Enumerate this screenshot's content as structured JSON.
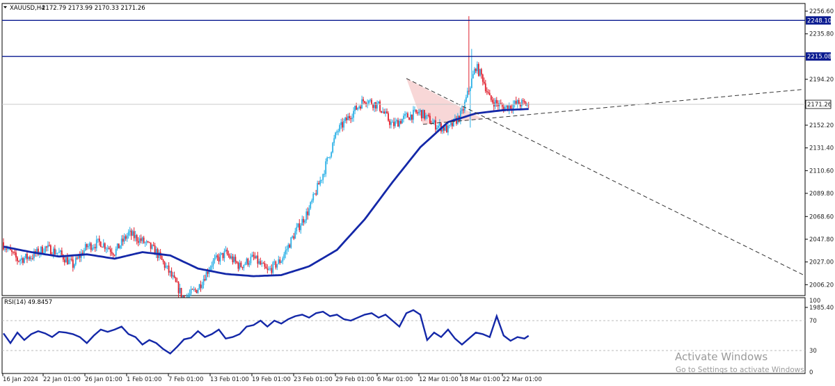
{
  "header": {
    "symbol": "XAUUSD,H4",
    "ohlc": "2172.79 2173.99 2170.33 2171.26"
  },
  "rsi_header": "RSI(14) 49.8457",
  "watermark": {
    "title": "Activate Windows",
    "subtitle": "Go to Settings to activate Windows."
  },
  "colors": {
    "bull_candle": "#2ab0e6",
    "bear_candle": "#e0202e",
    "moving_average": "#1428a8",
    "hline": "#0a1a90",
    "rsi_line": "#1428a8",
    "triangle_fill": "#f6c9c9"
  },
  "chart_data": [
    {
      "type": "candlestick",
      "symbol": "XAUUSD",
      "timeframe": "H4",
      "y_ticks": [
        "2256.60",
        "2235.80",
        "2194.20",
        "2152.20",
        "2131.40",
        "2110.60",
        "2089.80",
        "2068.60",
        "2047.80",
        "2027.00",
        "2006.20",
        "1985.40"
      ],
      "ylim": [
        1979,
        2262
      ],
      "x_ticks": [
        "16 Jan 2024",
        "22 Jan 01:00",
        "26 Jan 01:00",
        "1 Feb 01:00",
        "7 Feb 01:00",
        "13 Feb 01:00",
        "19 Feb 01:00",
        "23 Feb 01:00",
        "29 Feb 01:00",
        "6 Mar 01:00",
        "12 Mar 01:00",
        "18 Mar 01:00",
        "22 Mar 01:00"
      ],
      "price_levels": [
        {
          "value": "2248.10",
          "label": "2248.10"
        },
        {
          "value": "2215.08",
          "label": "2215.08"
        }
      ],
      "current_price": {
        "value": "2171.26",
        "label": "2171.26"
      },
      "close_path": [
        [
          0,
          2043
        ],
        [
          10,
          2029
        ],
        [
          20,
          2032
        ],
        [
          30,
          2040
        ],
        [
          40,
          2035
        ],
        [
          50,
          2024
        ],
        [
          60,
          2041
        ],
        [
          70,
          2045
        ],
        [
          80,
          2036
        ],
        [
          90,
          2053
        ],
        [
          100,
          2046
        ],
        [
          110,
          2036
        ],
        [
          120,
          2016
        ],
        [
          130,
          1993
        ],
        [
          140,
          2003
        ],
        [
          150,
          2026
        ],
        [
          160,
          2035
        ],
        [
          170,
          2023
        ],
        [
          180,
          2031
        ],
        [
          190,
          2018
        ],
        [
          200,
          2029
        ],
        [
          210,
          2054
        ],
        [
          220,
          2075
        ],
        [
          230,
          2108
        ],
        [
          240,
          2146
        ],
        [
          250,
          2162
        ],
        [
          260,
          2176
        ],
        [
          270,
          2170
        ],
        [
          280,
          2152
        ],
        [
          290,
          2160
        ],
        [
          300,
          2164
        ],
        [
          310,
          2153
        ],
        [
          320,
          2148
        ],
        [
          330,
          2163
        ],
        [
          340,
          2206
        ],
        [
          345,
          2195
        ],
        [
          350,
          2176
        ],
        [
          360,
          2168
        ],
        [
          370,
          2172
        ],
        [
          378,
          2171.3
        ]
      ],
      "moving_average_path": [
        [
          0,
          2041
        ],
        [
          20,
          2036
        ],
        [
          40,
          2032
        ],
        [
          60,
          2034
        ],
        [
          80,
          2030
        ],
        [
          100,
          2036
        ],
        [
          120,
          2033
        ],
        [
          140,
          2021
        ],
        [
          160,
          2016
        ],
        [
          180,
          2014
        ],
        [
          200,
          2015
        ],
        [
          220,
          2023
        ],
        [
          240,
          2038
        ],
        [
          260,
          2066
        ],
        [
          280,
          2100
        ],
        [
          300,
          2132
        ],
        [
          320,
          2155
        ],
        [
          340,
          2163
        ],
        [
          360,
          2166
        ],
        [
          378,
          2167
        ]
      ],
      "trendlines": [
        {
          "from": [
            290,
            2195
          ],
          "to": [
            576,
            2015
          ],
          "style": "dashed"
        },
        {
          "from": [
            302,
            2153
          ],
          "to": [
            576,
            2185
          ],
          "style": "dashed"
        }
      ]
    },
    {
      "type": "line",
      "indicator": "RSI(14)",
      "y_ticks": [
        "100",
        "70",
        "30",
        "0"
      ],
      "ylim": [
        0,
        100
      ],
      "levels": [
        70,
        30
      ],
      "values": [
        [
          0,
          53
        ],
        [
          5,
          40
        ],
        [
          10,
          54
        ],
        [
          15,
          44
        ],
        [
          20,
          52
        ],
        [
          25,
          56
        ],
        [
          30,
          53
        ],
        [
          35,
          48
        ],
        [
          40,
          55
        ],
        [
          45,
          54
        ],
        [
          50,
          52
        ],
        [
          55,
          48
        ],
        [
          60,
          40
        ],
        [
          65,
          50
        ],
        [
          70,
          58
        ],
        [
          75,
          55
        ],
        [
          80,
          58
        ],
        [
          85,
          62
        ],
        [
          90,
          52
        ],
        [
          95,
          48
        ],
        [
          100,
          38
        ],
        [
          105,
          44
        ],
        [
          110,
          40
        ],
        [
          115,
          32
        ],
        [
          120,
          26
        ],
        [
          125,
          35
        ],
        [
          130,
          45
        ],
        [
          135,
          47
        ],
        [
          140,
          56
        ],
        [
          145,
          48
        ],
        [
          150,
          52
        ],
        [
          155,
          58
        ],
        [
          160,
          46
        ],
        [
          165,
          48
        ],
        [
          170,
          52
        ],
        [
          175,
          62
        ],
        [
          180,
          64
        ],
        [
          185,
          70
        ],
        [
          190,
          62
        ],
        [
          195,
          70
        ],
        [
          200,
          66
        ],
        [
          205,
          72
        ],
        [
          210,
          76
        ],
        [
          215,
          78
        ],
        [
          220,
          74
        ],
        [
          225,
          80
        ],
        [
          230,
          82
        ],
        [
          235,
          76
        ],
        [
          240,
          78
        ],
        [
          245,
          72
        ],
        [
          250,
          70
        ],
        [
          255,
          74
        ],
        [
          260,
          78
        ],
        [
          265,
          80
        ],
        [
          270,
          74
        ],
        [
          275,
          78
        ],
        [
          280,
          70
        ],
        [
          285,
          62
        ],
        [
          290,
          80
        ],
        [
          295,
          84
        ],
        [
          300,
          78
        ],
        [
          305,
          44
        ],
        [
          310,
          54
        ],
        [
          315,
          48
        ],
        [
          320,
          58
        ],
        [
          325,
          46
        ],
        [
          330,
          38
        ],
        [
          335,
          46
        ],
        [
          340,
          54
        ],
        [
          345,
          52
        ],
        [
          350,
          48
        ],
        [
          355,
          76
        ],
        [
          360,
          50
        ],
        [
          365,
          43
        ],
        [
          370,
          48
        ],
        [
          375,
          46
        ],
        [
          378,
          49.85
        ]
      ]
    }
  ]
}
